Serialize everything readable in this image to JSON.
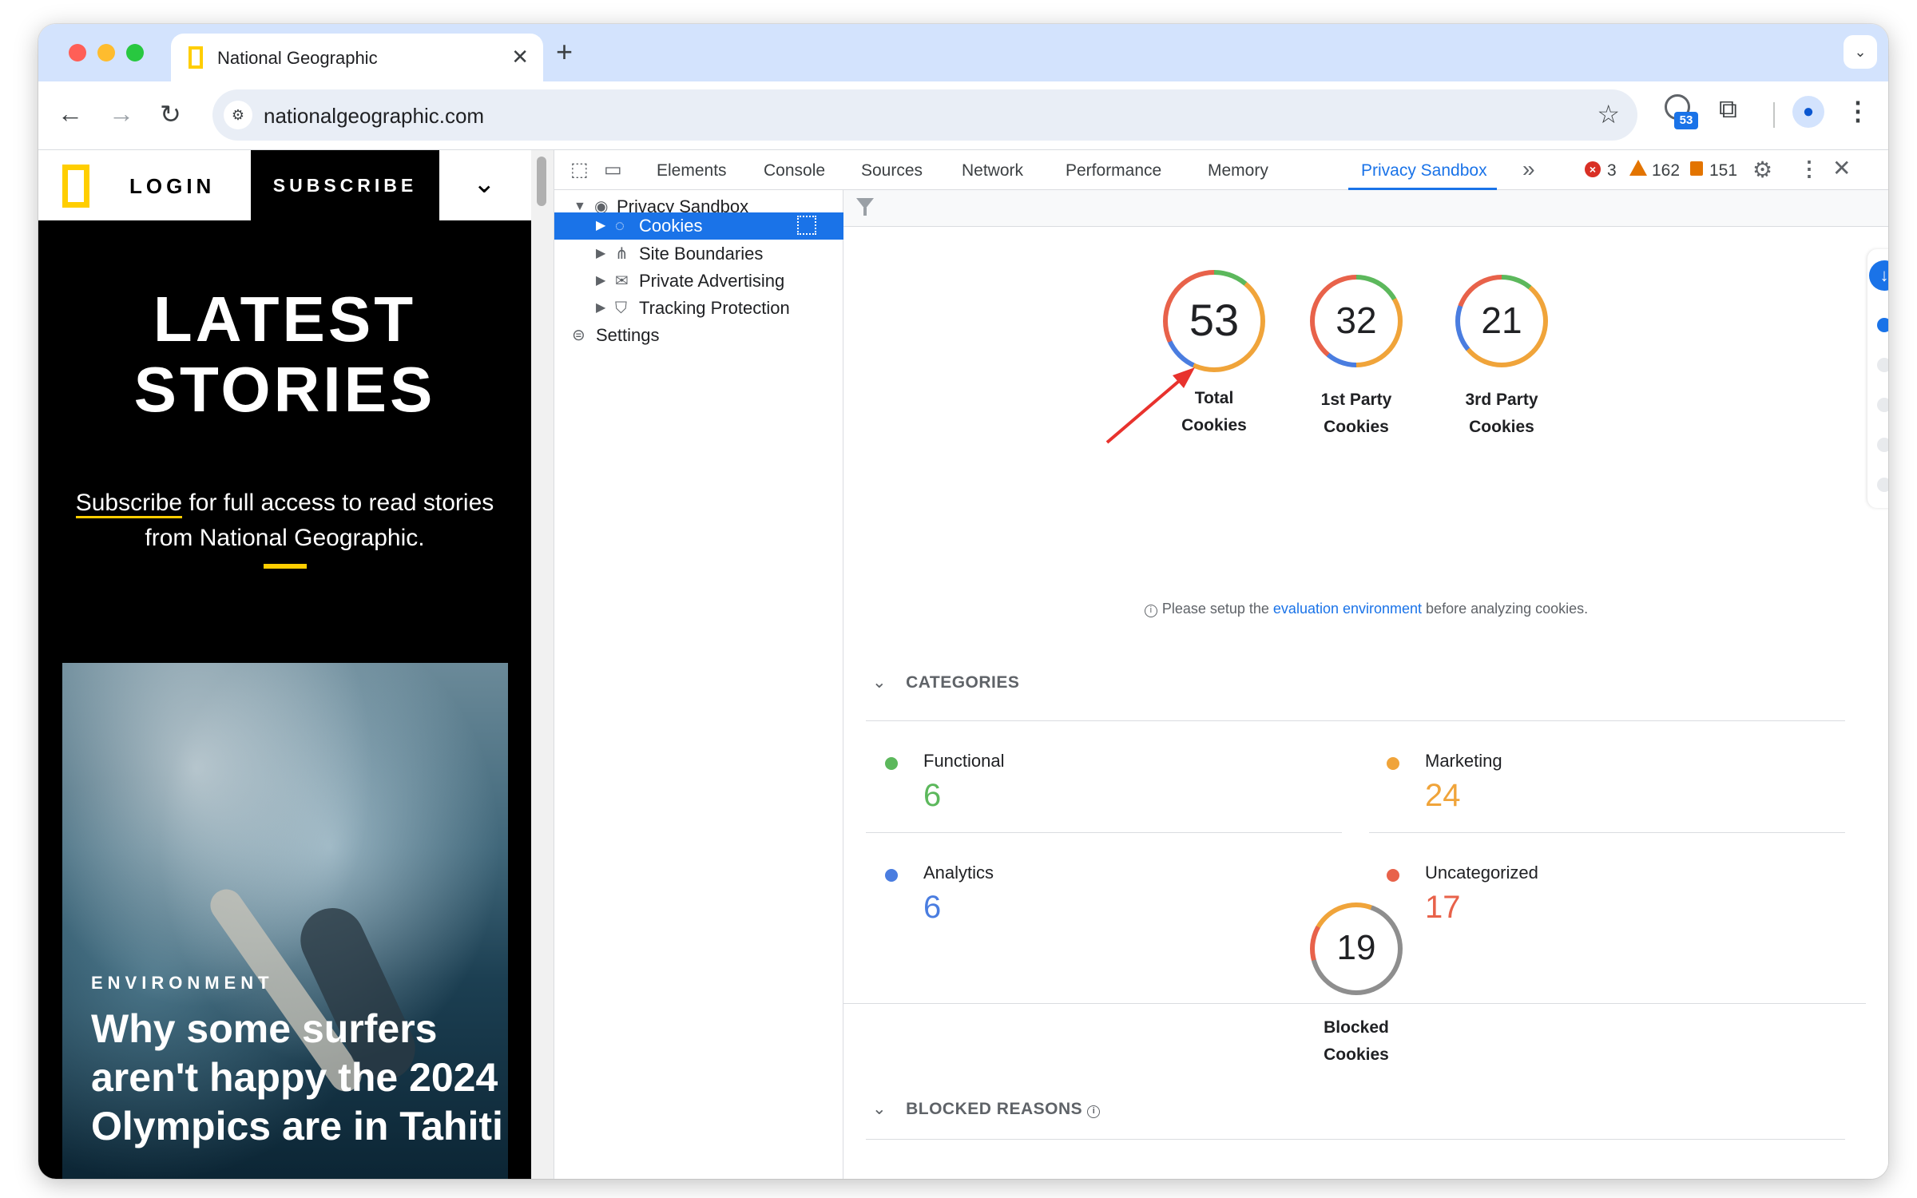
{
  "browser": {
    "tab_title": "National Geographic",
    "tab_close": "✕",
    "new_tab": "+",
    "tab_menu": "⌄",
    "url": "nationalgeographic.com",
    "extension_badge": "53"
  },
  "site": {
    "login": "LOGIN",
    "subscribe": "SUBSCRIBE",
    "heading_line1": "LATEST",
    "heading_line2": "STORIES",
    "subscribe_link": "Subscribe",
    "subscribe_rest": " for full access to read stories from National Geographic.",
    "kicker": "ENVIRONMENT",
    "headline": "Why some surfers aren't happy the 2024 Olympics are in Tahiti"
  },
  "devtools": {
    "tabs": [
      "Elements",
      "Console",
      "Sources",
      "Network",
      "Performance",
      "Memory",
      "Privacy Sandbox"
    ],
    "active_tab": "Privacy Sandbox",
    "errors": "3",
    "warnings": "162",
    "issues": "151",
    "tree": {
      "root": "Privacy Sandbox",
      "cookies": "Cookies",
      "site_boundaries": "Site Boundaries",
      "private_advertising": "Private Advertising",
      "tracking_protection": "Tracking Protection",
      "settings": "Settings"
    },
    "stats": {
      "total": {
        "value": "53",
        "label_1": "Total",
        "label_2": "Cookies"
      },
      "first_party": {
        "value": "32",
        "label_1": "1st Party",
        "label_2": "Cookies"
      },
      "third_party": {
        "value": "21",
        "label_1": "3rd Party",
        "label_2": "Cookies"
      },
      "blocked": {
        "value": "19",
        "label_1": "Blocked",
        "label_2": "Cookies"
      }
    },
    "notice": {
      "before": "Please setup the ",
      "link": "evaluation environment",
      "after": " before analyzing cookies."
    },
    "categories_heading": "CATEGORIES",
    "categories": [
      {
        "name": "Functional",
        "value": "6",
        "color": "#5cb85c"
      },
      {
        "name": "Marketing",
        "value": "24",
        "color": "#f0a43a"
      },
      {
        "name": "Analytics",
        "value": "6",
        "color": "#4a7de0"
      },
      {
        "name": "Uncategorized",
        "value": "17",
        "color": "#e8624a"
      }
    ],
    "blocked_reasons_heading": "BLOCKED REASONS"
  }
}
